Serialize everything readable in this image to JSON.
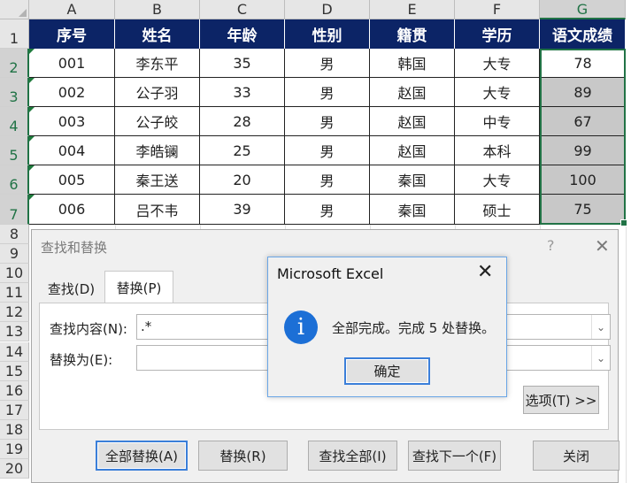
{
  "sheet": {
    "columns": [
      "A",
      "B",
      "C",
      "D",
      "E",
      "F",
      "G"
    ],
    "rows": [
      "1",
      "2",
      "3",
      "4",
      "5",
      "6",
      "7",
      "8",
      "9",
      "10",
      "11",
      "12",
      "13",
      "14",
      "15",
      "16",
      "17",
      "18",
      "19",
      "20"
    ],
    "headers": [
      "序号",
      "姓名",
      "年龄",
      "性别",
      "籍贯",
      "学历",
      "语文成绩"
    ],
    "data": [
      [
        "001",
        "李东平",
        "35",
        "男",
        "韩国",
        "大专",
        "78"
      ],
      [
        "002",
        "公子羽",
        "33",
        "男",
        "赵国",
        "大专",
        "89"
      ],
      [
        "003",
        "公子皎",
        "28",
        "男",
        "赵国",
        "中专",
        "67"
      ],
      [
        "004",
        "李皓镧",
        "25",
        "男",
        "赵国",
        "本科",
        "99"
      ],
      [
        "005",
        "秦王送",
        "20",
        "男",
        "秦国",
        "大专",
        "100"
      ],
      [
        "006",
        "吕不韦",
        "39",
        "男",
        "秦国",
        "硕士",
        "75"
      ]
    ],
    "selected_column": "G",
    "header_color": "#0c2466",
    "selection_color": "#217346"
  },
  "find_replace": {
    "title": "查找和替换",
    "help": "?",
    "close": "✕",
    "tabs": [
      "查找(D)",
      "替换(P)"
    ],
    "active_tab": "替换(P)",
    "find_label": "查找内容(N):",
    "find_value": ".*",
    "replace_label": "替换为(E):",
    "replace_value": "",
    "options_button": "选项(T) >>",
    "buttons": {
      "replace_all": "全部替换(A)",
      "replace": "替换(R)",
      "find_all": "查找全部(I)",
      "find_next": "查找下一个(F)",
      "close": "关闭"
    }
  },
  "message_box": {
    "title": "Microsoft Excel",
    "close": "✕",
    "icon": "info-icon",
    "icon_glyph": "i",
    "message": "全部完成。完成 5 处替换。",
    "ok_button": "确定",
    "accent_color": "#1c6fd6"
  }
}
